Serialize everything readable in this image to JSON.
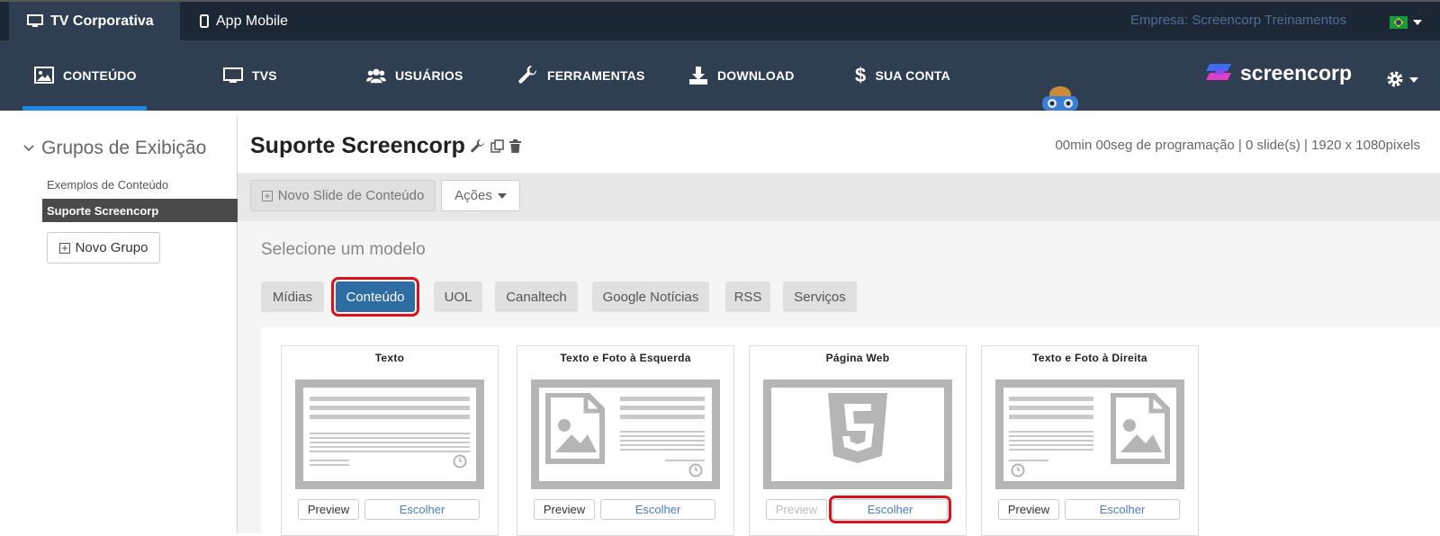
{
  "topbar": {
    "tabs": [
      {
        "label": "TV Corporativa",
        "icon": "monitor-icon"
      },
      {
        "label": "App Mobile",
        "icon": "phone-icon"
      }
    ],
    "company": "Empresa: Screencorp Treinamentos",
    "flag": "brazil-flag-icon"
  },
  "nav": {
    "items": [
      {
        "label": "CONTEÚDO",
        "icon": "image-icon"
      },
      {
        "label": "TVS",
        "icon": "monitor-icon"
      },
      {
        "label": "USUÁRIOS",
        "icon": "users-icon"
      },
      {
        "label": "FERRAMENTAS",
        "icon": "wrench-icon"
      },
      {
        "label": "DOWNLOAD",
        "icon": "download-icon"
      },
      {
        "label": "SUA CONTA",
        "icon": "dollar-icon"
      }
    ],
    "logo": "screencorp",
    "accent": "#1e88e5"
  },
  "sidebar": {
    "title": "Grupos de Exibição",
    "items": [
      "Exemplos de Conteúdo",
      "Suporte Screencorp"
    ],
    "new_group": "Novo Grupo"
  },
  "main": {
    "title": "Suporte Screencorp",
    "info": "00min 00seg de programação | 0 slide(s) | 1920 x 1080pixels",
    "new_slide": "Novo Slide de Conteúdo",
    "actions": "Ações",
    "select_model": "Selecione um modelo",
    "tabs": [
      "Mídias",
      "Conteúdo",
      "UOL",
      "Canaltech",
      "Google Notícias",
      "RSS",
      "Serviços"
    ],
    "active_tab": "Conteúdo",
    "cards": [
      {
        "title": "Texto",
        "preview": "Preview",
        "choose": "Escolher"
      },
      {
        "title": "Texto e Foto à Esquerda",
        "preview": "Preview",
        "choose": "Escolher"
      },
      {
        "title": "Página Web",
        "preview": "Preview",
        "choose": "Escolher"
      },
      {
        "title": "Texto e Foto à Direita",
        "preview": "Preview",
        "choose": "Escolher"
      }
    ]
  },
  "colors": {
    "topbar": "#1c2736",
    "navbar": "#2f3e51",
    "highlight": "#d9121b",
    "primary": "#2e6da4"
  }
}
